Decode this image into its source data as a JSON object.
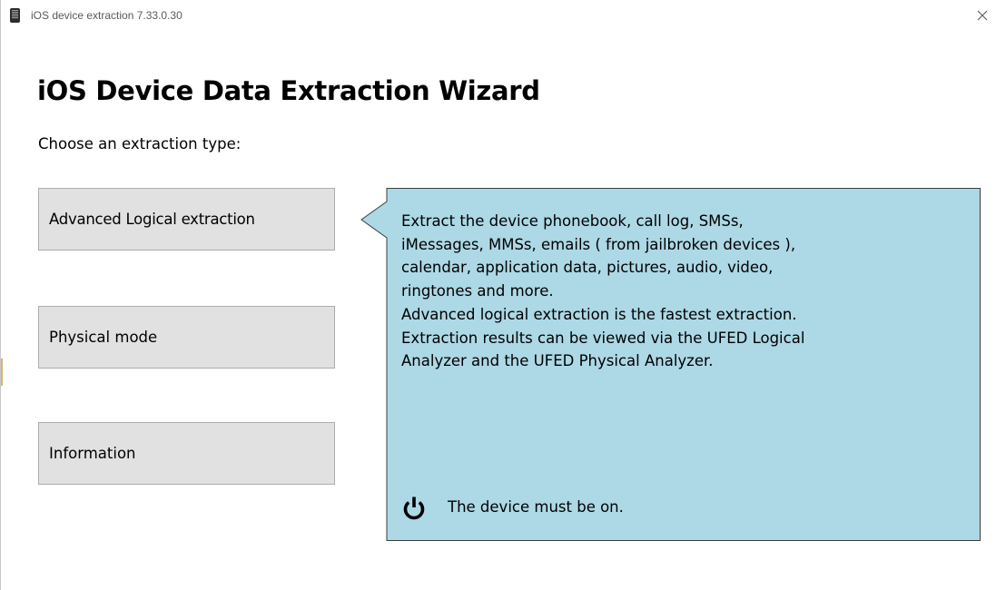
{
  "window": {
    "title": "iOS device extraction 7.33.0.30",
    "icon": "phone-device-icon",
    "close_icon": "close-icon"
  },
  "wizard": {
    "heading": "iOS Device Data Extraction Wizard",
    "prompt": "Choose an extraction type:"
  },
  "options": [
    {
      "label": "Advanced Logical extraction",
      "selected": true
    },
    {
      "label": "Physical mode",
      "selected": false
    },
    {
      "label": "Information",
      "selected": false
    }
  ],
  "description": {
    "text": "Extract the device phonebook, call log, SMSs,\niMessages, MMSs, emails ( from jailbroken devices ),\ncalendar, application data, pictures, audio, video,\nringtones  and more.\nAdvanced logical extraction is the fastest extraction.\nExtraction results can be viewed via the UFED Logical\nAnalyzer and the UFED Physical Analyzer.",
    "notice_icon": "power-icon",
    "notice": "The device must be on."
  },
  "colors": {
    "panel_background": "#add8e6",
    "panel_border": "#3c3c3c",
    "button_background": "#e1e1e1",
    "button_border": "#adadad"
  }
}
